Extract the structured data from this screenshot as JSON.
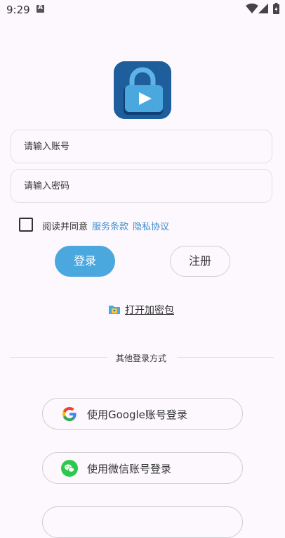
{
  "status_bar": {
    "time": "9:29"
  },
  "login_form": {
    "account_placeholder": "请输入账号",
    "password_placeholder": "请输入密码"
  },
  "agreement": {
    "text": "阅读并同意",
    "terms_link": "服务条款",
    "privacy_link": "隐私协议",
    "checked": false
  },
  "actions": {
    "login_label": "登录",
    "register_label": "注册",
    "open_package_label": "打开加密包"
  },
  "other_login": {
    "divider_text": "其他登录方式",
    "google_label": "使用Google账号登录",
    "wechat_label": "使用微信账号登录"
  },
  "colors": {
    "accent": "#4aa8df",
    "link": "#3d8fd0",
    "logo_bg": "#1f5e9c",
    "background": "#fcf8fd"
  }
}
